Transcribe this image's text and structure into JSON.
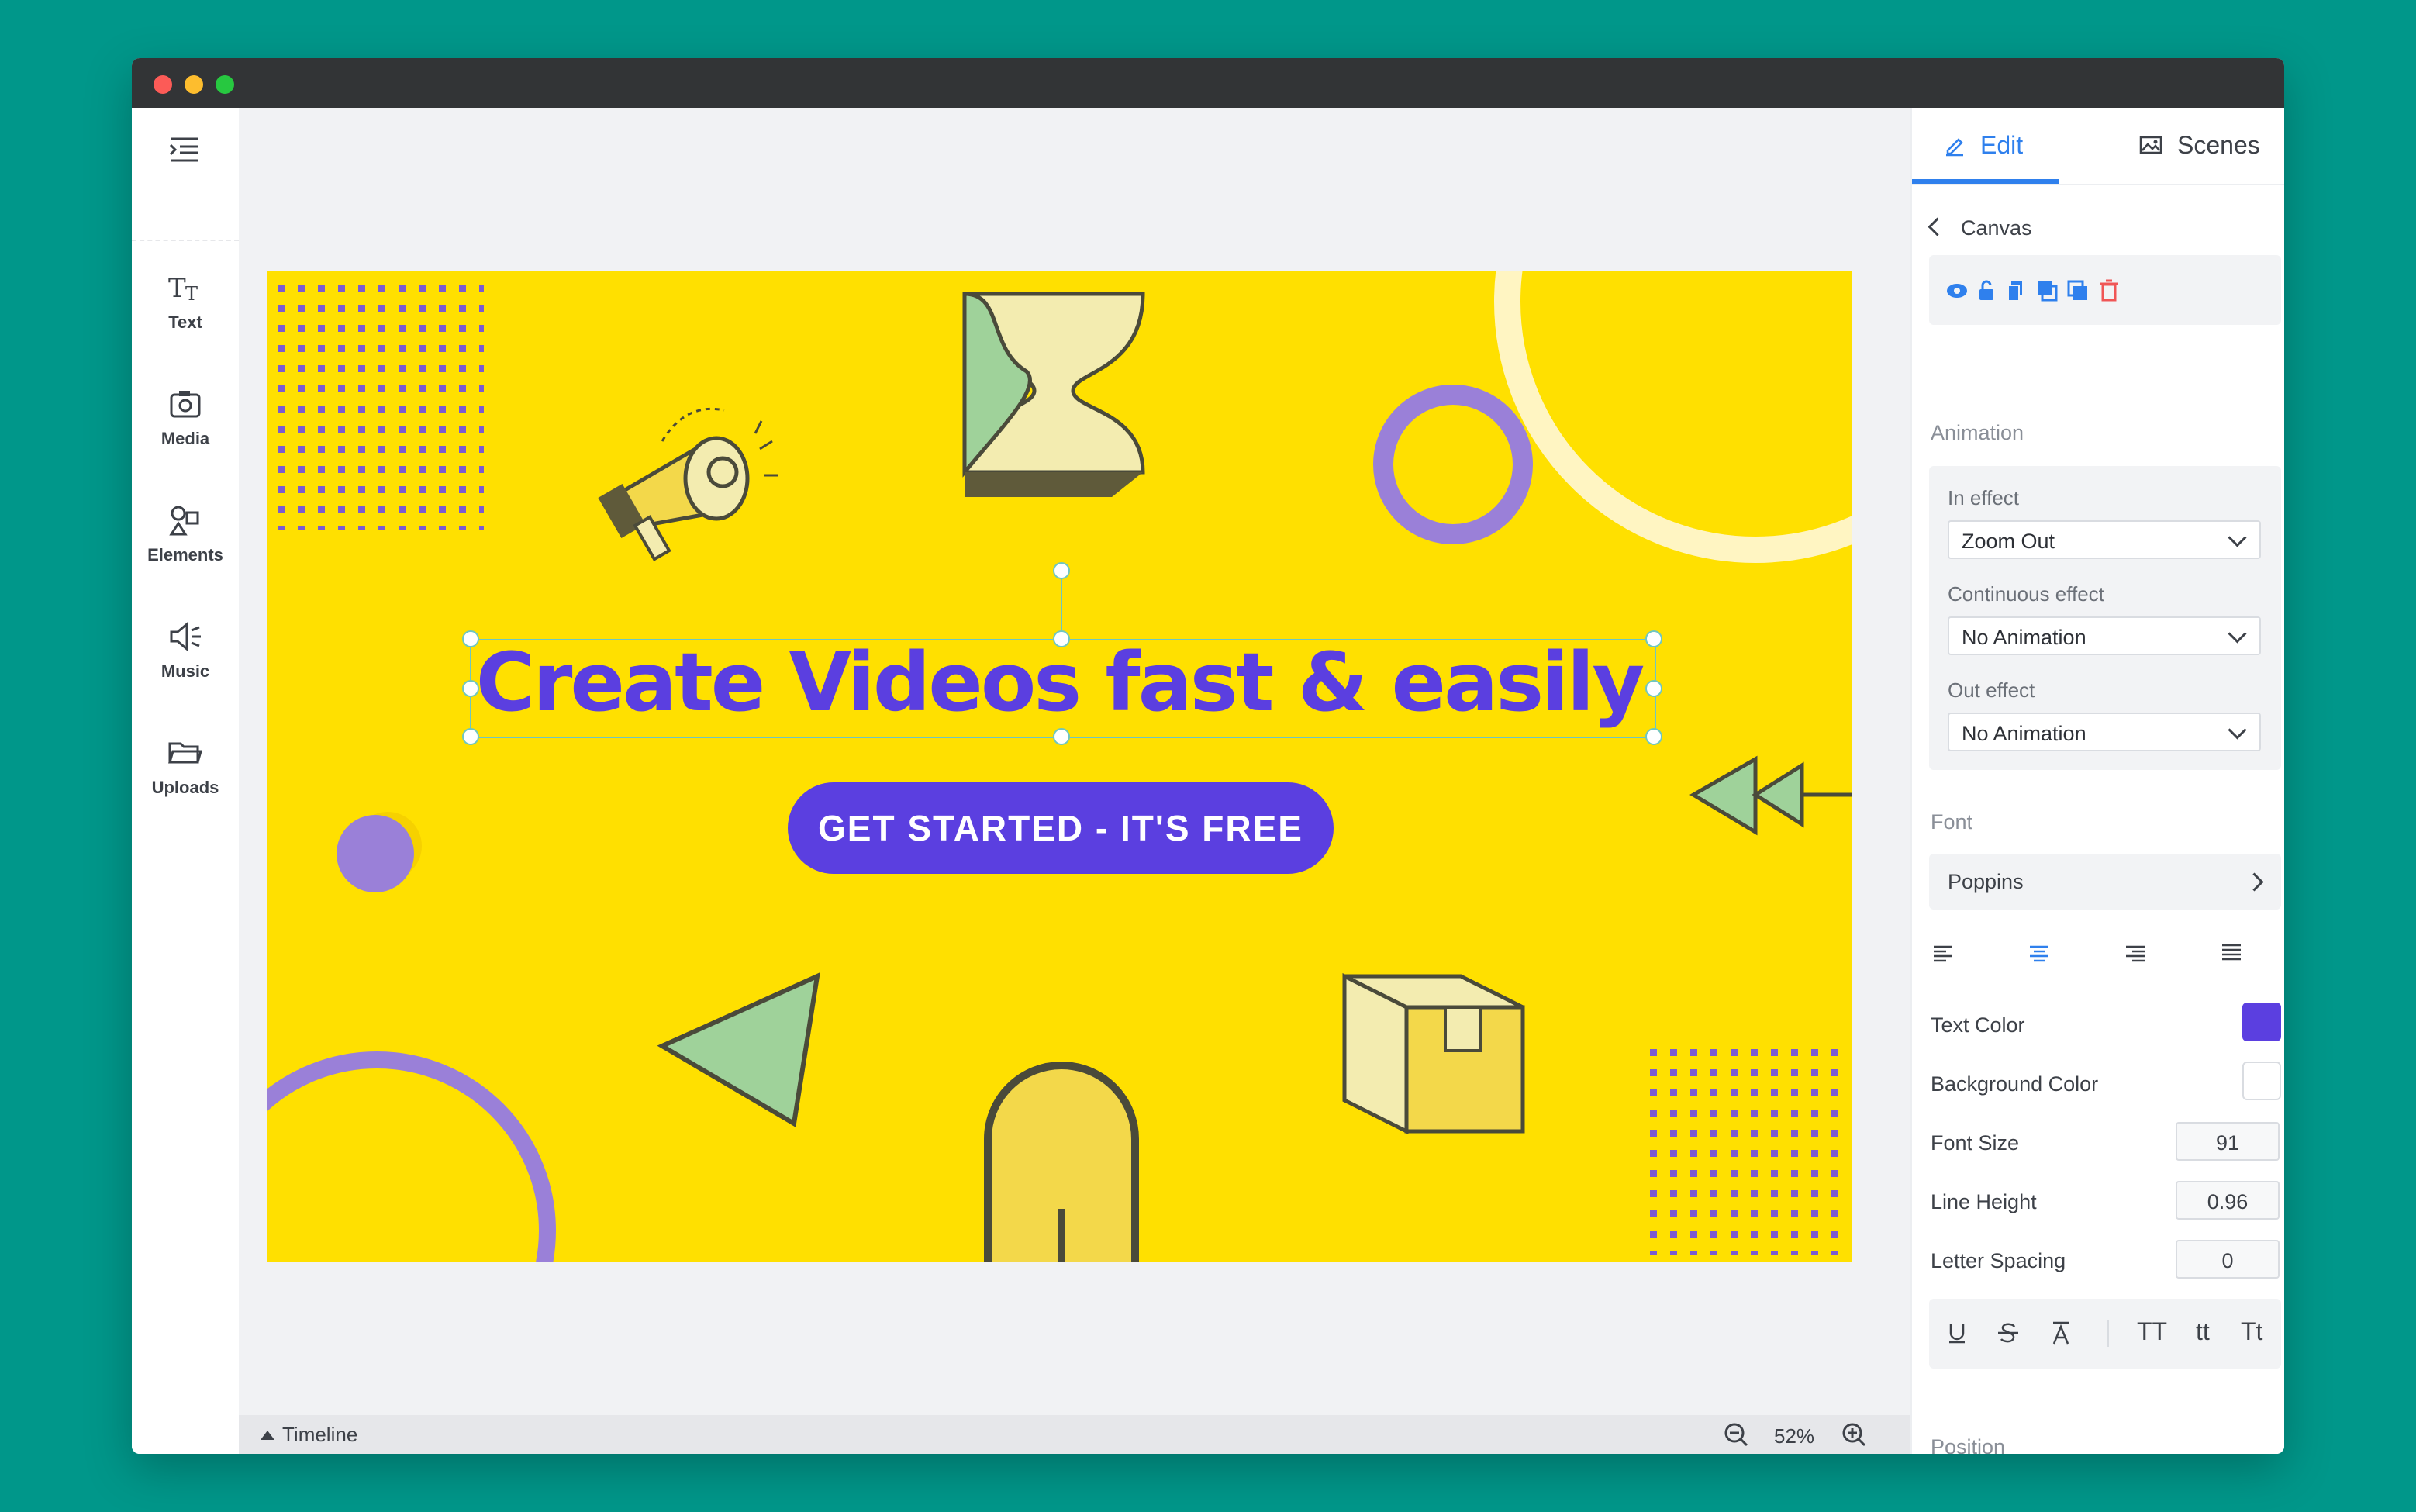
{
  "window": {
    "controls": [
      "close",
      "minimize",
      "maximize"
    ]
  },
  "sidebar": {
    "menu_icon": "menu-icon",
    "items": [
      {
        "label": "Text",
        "icon": "text-icon"
      },
      {
        "label": "Media",
        "icon": "camera-icon"
      },
      {
        "label": "Elements",
        "icon": "shapes-icon"
      },
      {
        "label": "Music",
        "icon": "speaker-icon"
      },
      {
        "label": "Uploads",
        "icon": "folder-icon"
      }
    ]
  },
  "canvas": {
    "headline": "Create Videos fast & easily",
    "cta": "GET STARTED - IT'S FREE",
    "background_color": "#ffe000",
    "accent_color": "#5b3fe0"
  },
  "bottombar": {
    "timeline_label": "Timeline",
    "zoom": "52%"
  },
  "panel": {
    "tabs": {
      "edit": "Edit",
      "scenes": "Scenes"
    },
    "breadcrumb": "Canvas",
    "tools": [
      "eye-icon",
      "unlock-icon",
      "duplicate-icon",
      "bring-forward-icon",
      "send-backward-icon",
      "trash-icon"
    ],
    "animation": {
      "section": "Animation",
      "in_label": "In effect",
      "in_value": "Zoom Out",
      "continuous_label": "Continuous effect",
      "continuous_value": "No Animation",
      "out_label": "Out effect",
      "out_value": "No Animation"
    },
    "font": {
      "section": "Font",
      "family": "Poppins",
      "alignment": "center"
    },
    "text_color_label": "Text Color",
    "text_color": "#5b3fe0",
    "bg_color_label": "Background Color",
    "bg_color": "#ffffff",
    "font_size_label": "Font Size",
    "font_size": "91",
    "line_height_label": "Line Height",
    "line_height": "0.96",
    "letter_spacing_label": "Letter Spacing",
    "letter_spacing": "0",
    "style_buttons": {
      "uppercase": "TT",
      "lowercase": "tt",
      "capitalize": "Tt"
    },
    "position_label": "Position"
  }
}
